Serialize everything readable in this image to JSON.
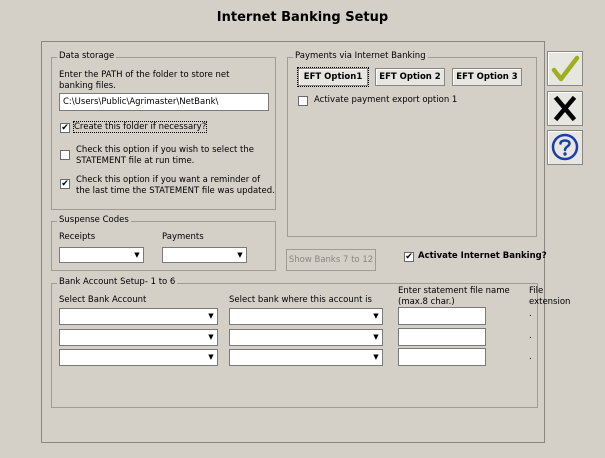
{
  "window": {
    "title": "Internet Banking Setup"
  },
  "data_storage": {
    "label": "Data storage",
    "path_prompt": "Enter the PATH of the folder to store net banking files.",
    "path_value": "C:\\Users\\Public\\Agrimaster\\NetBank\\",
    "create_folder": {
      "label": "Create this folder if necessary?",
      "checked": true
    },
    "select_statement": {
      "label": "Check this option if you wish to select the STATEMENT file at run time.",
      "checked": false
    },
    "reminder": {
      "label": "Check this option if you want a reminder of the last time the STATEMENT file was updated.",
      "checked": true
    }
  },
  "payments": {
    "label": "Payments via Internet Banking",
    "eft_buttons": [
      "EFT Option1",
      "EFT Option 2",
      "EFT Option 3"
    ],
    "activate_export": {
      "label": "Activate payment export option 1",
      "checked": false
    }
  },
  "suspense": {
    "label": "Suspense Codes",
    "receipts_label": "Receipts",
    "payments_label": "Payments",
    "receipts_value": "",
    "payments_value": ""
  },
  "show_banks_label": "Show Banks 7 to 12",
  "activate_internet_banking": {
    "label": "Activate Internet Banking?",
    "checked": true
  },
  "bank_setup": {
    "label": "Bank Account Setup- 1 to 6",
    "col_account": "Select Bank Account",
    "col_bank": "Select bank where this account is",
    "col_statement": "Enter statement file name (max.8 char.)",
    "col_extension": "File extension",
    "rows": [
      {
        "account": "",
        "bank": "",
        "statement": "",
        "extension": "."
      },
      {
        "account": "",
        "bank": "",
        "statement": "",
        "extension": "."
      },
      {
        "account": "",
        "bank": "",
        "statement": "",
        "extension": "."
      }
    ]
  },
  "side_buttons": {
    "ok_icon": "checkmark-icon",
    "cancel_icon": "close-icon",
    "help_icon": "help-icon",
    "colors": {
      "ok": "#9fae1e",
      "cancel": "#000000",
      "help": "#1a3fa8"
    }
  }
}
